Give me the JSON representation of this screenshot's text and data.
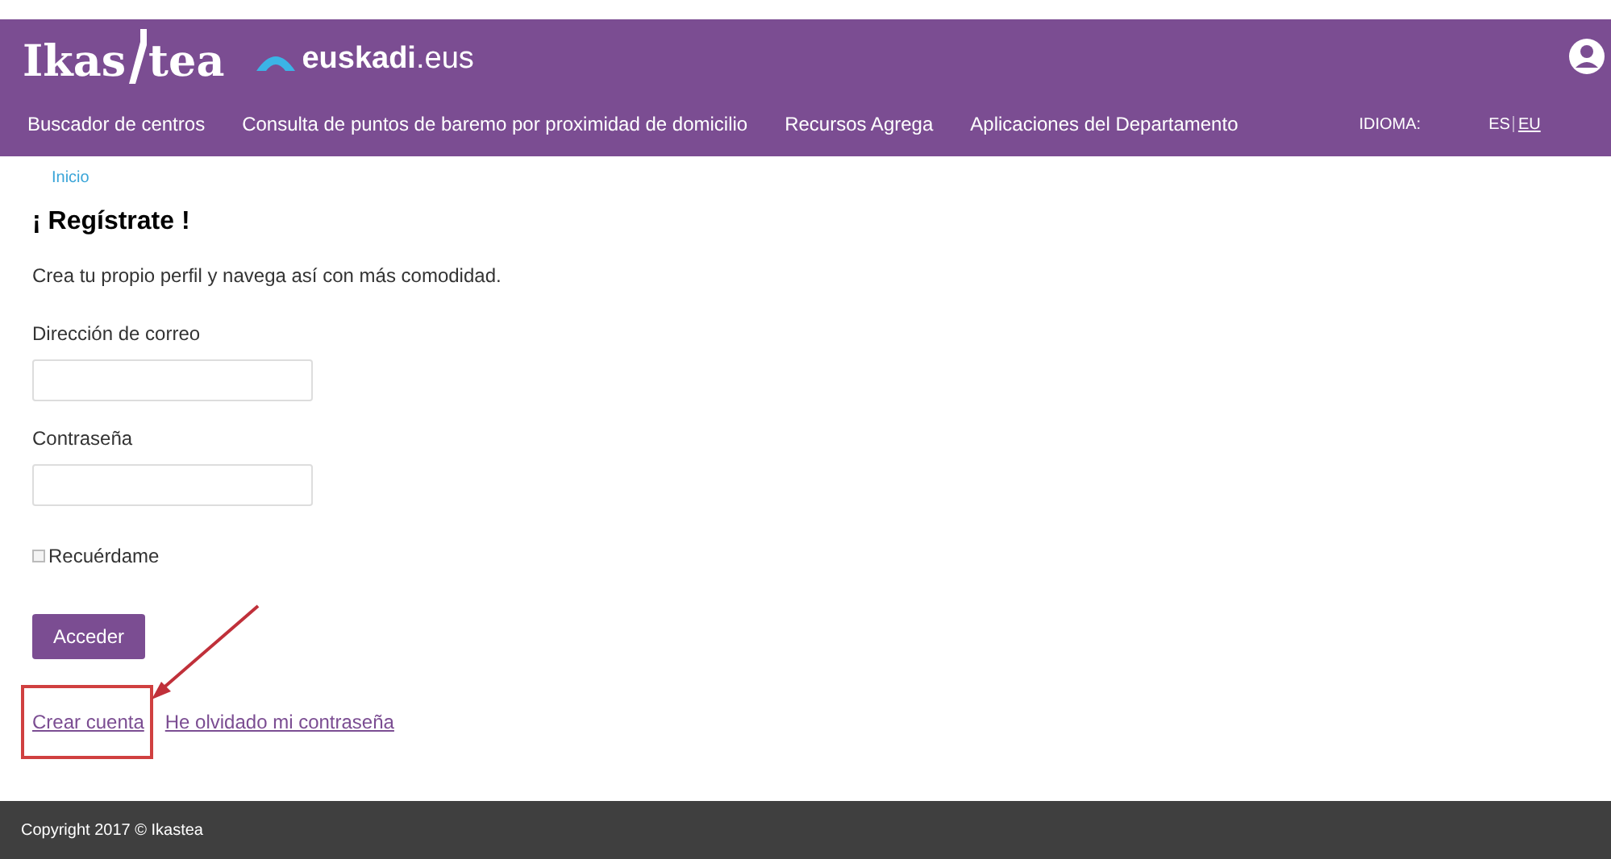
{
  "header": {
    "logo": {
      "part_1": "Ikas",
      "part_2": "tea"
    },
    "partner": "**euskadi**.eus",
    "nav": [
      "Buscador de centros",
      "Consulta de puntos de baremo por proximidad de domicilio",
      "Recursos Agrega",
      "Aplicaciones del Departamento"
    ],
    "language_label": "IDIOMA:",
    "languages": [
      {
        "label": "ES",
        "selected": false
      },
      {
        "label": "EU",
        "selected": true
      }
    ]
  },
  "breadcrumb": "Inicio",
  "title": "¡ Regístrate !",
  "intro": "Crea tu propio perfil y navega así con más comodidad.",
  "fields": [
    {
      "label": "Dirección de correo"
    },
    {
      "label": "Contraseña"
    }
  ],
  "remember": {
    "label": "Recuérdame",
    "checked": false
  },
  "submit": "Acceder",
  "links": [
    {
      "label": "Crear cuenta",
      "highlighted": true
    },
    {
      "label": "He olvidado mi contraseña",
      "highlighted": false
    }
  ],
  "footer": "Copyright 2017 © Ikastea"
}
